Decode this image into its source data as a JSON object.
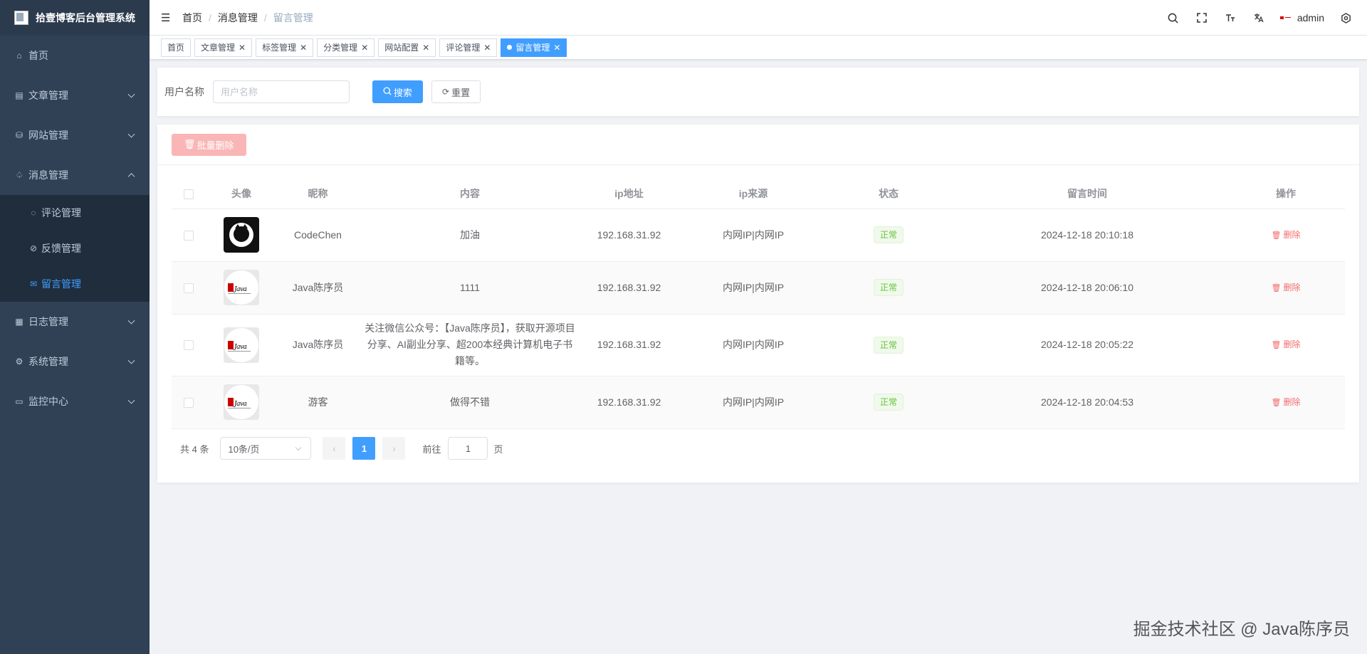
{
  "app": {
    "title": "拾壹博客后台管理系统"
  },
  "sidebar": {
    "items": [
      {
        "label": "首页",
        "icon": "home-icon"
      },
      {
        "label": "文章管理",
        "icon": "document-icon"
      },
      {
        "label": "网站管理",
        "icon": "website-icon"
      },
      {
        "label": "消息管理",
        "icon": "bell-icon",
        "expanded": true,
        "children": [
          {
            "label": "评论管理",
            "icon": "comment-icon"
          },
          {
            "label": "反馈管理",
            "icon": "link-icon"
          },
          {
            "label": "留言管理",
            "icon": "message-icon",
            "active": true
          }
        ]
      },
      {
        "label": "日志管理",
        "icon": "log-icon"
      },
      {
        "label": "系统管理",
        "icon": "gear-icon"
      },
      {
        "label": "监控中心",
        "icon": "monitor-icon"
      }
    ]
  },
  "header": {
    "breadcrumb": [
      "首页",
      "消息管理",
      "留言管理"
    ],
    "breadcrumb_sep": "/",
    "username": "admin"
  },
  "tags": [
    {
      "label": "首页",
      "closable": false
    },
    {
      "label": "文章管理",
      "closable": true
    },
    {
      "label": "标签管理",
      "closable": true
    },
    {
      "label": "分类管理",
      "closable": true
    },
    {
      "label": "网站配置",
      "closable": true
    },
    {
      "label": "评论管理",
      "closable": true
    },
    {
      "label": "留言管理",
      "closable": true,
      "active": true
    }
  ],
  "search": {
    "label": "用户名称",
    "placeholder": "用户名称",
    "search_btn": "搜索",
    "reset_btn": "重置"
  },
  "toolbar": {
    "batch_delete": "批量删除"
  },
  "table": {
    "columns": [
      "头像",
      "昵称",
      "内容",
      "ip地址",
      "ip来源",
      "状态",
      "留言时间",
      "操作"
    ],
    "rows": [
      {
        "avatar": "github",
        "nickname": "CodeChen",
        "content": "加油",
        "ip": "192.168.31.92",
        "ip_source": "内网IP|内网IP",
        "status": "正常",
        "time": "2024-12-18 20:10:18",
        "action": "删除"
      },
      {
        "avatar": "java",
        "nickname": "Java陈序员",
        "content": "1111",
        "ip": "192.168.31.92",
        "ip_source": "内网IP|内网IP",
        "status": "正常",
        "time": "2024-12-18 20:06:10",
        "action": "删除"
      },
      {
        "avatar": "java",
        "nickname": "Java陈序员",
        "content": "关注微信公众号：【Java陈序员】，获取开源项目分享、AI副业分享、超200本经典计算机电子书籍等。",
        "ip": "192.168.31.92",
        "ip_source": "内网IP|内网IP",
        "status": "正常",
        "time": "2024-12-18 20:05:22",
        "action": "删除"
      },
      {
        "avatar": "java",
        "nickname": "游客",
        "content": "做得不错",
        "ip": "192.168.31.92",
        "ip_source": "内网IP|内网IP",
        "status": "正常",
        "time": "2024-12-18 20:04:53",
        "action": "删除"
      }
    ],
    "avatar_logo_text": "Java"
  },
  "pagination": {
    "total_text": "共 4 条",
    "page_size": "10条/页",
    "current_page": "1",
    "goto_label": "前往",
    "goto_value": "1",
    "page_suffix": "页"
  },
  "watermark": "掘金技术社区 @ Java陈序员",
  "colors": {
    "sidebar_bg": "#304156",
    "primary": "#409eff",
    "danger": "#f56c6c",
    "success": "#67c23a"
  }
}
